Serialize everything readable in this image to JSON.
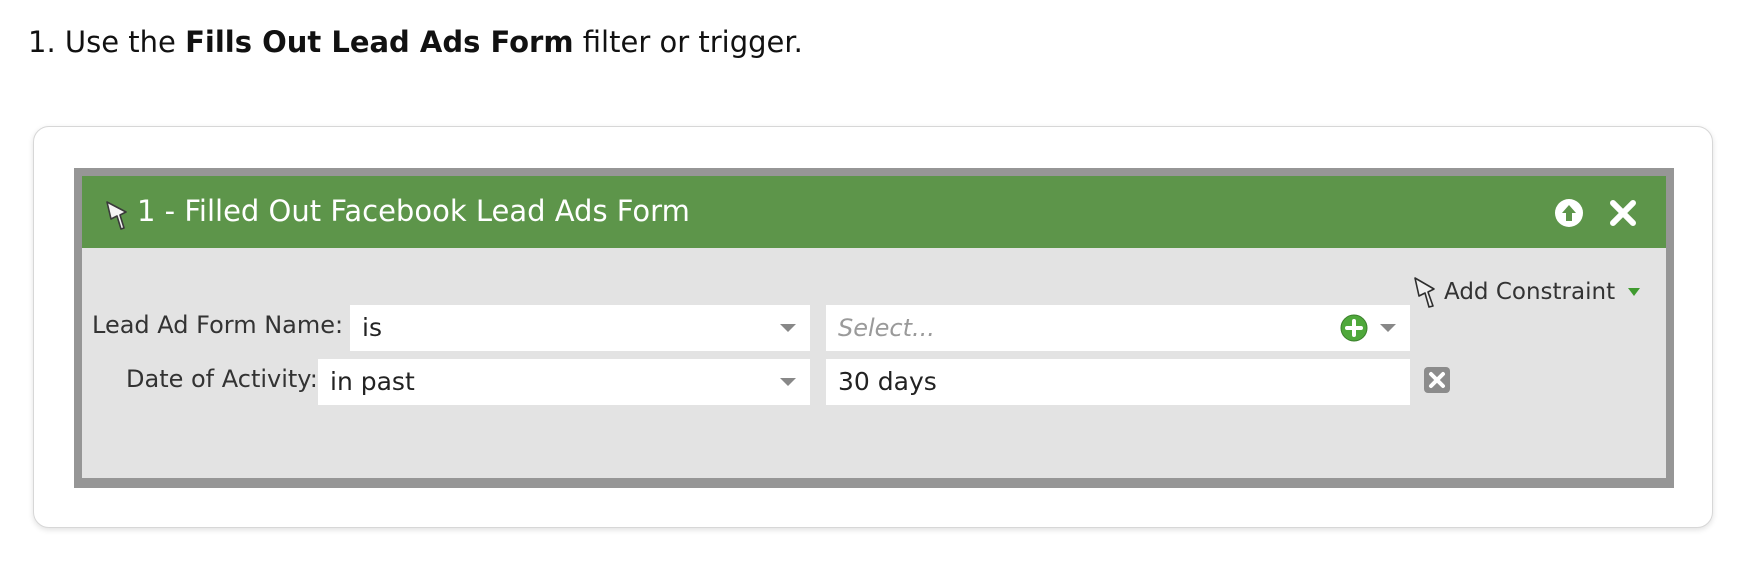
{
  "instruction": {
    "prefix": "1. Use the ",
    "bold": "Fills Out Lead Ads Form",
    "suffix": " filter or trigger."
  },
  "filter": {
    "title": "1 - Filled Out Facebook Lead Ads Form",
    "header_color": "#5d954a",
    "icons": {
      "pin": "pin-icon",
      "move_up": "arrow-up-circle-icon",
      "close": "close-x-icon"
    },
    "add_constraint_label": "Add Constraint",
    "rows": [
      {
        "label": "Lead Ad Form Name:",
        "operator": "is",
        "value_placeholder": "Select..."
      },
      {
        "label": "Date of Activity:",
        "operator": "in past",
        "value": "30 days"
      }
    ]
  }
}
